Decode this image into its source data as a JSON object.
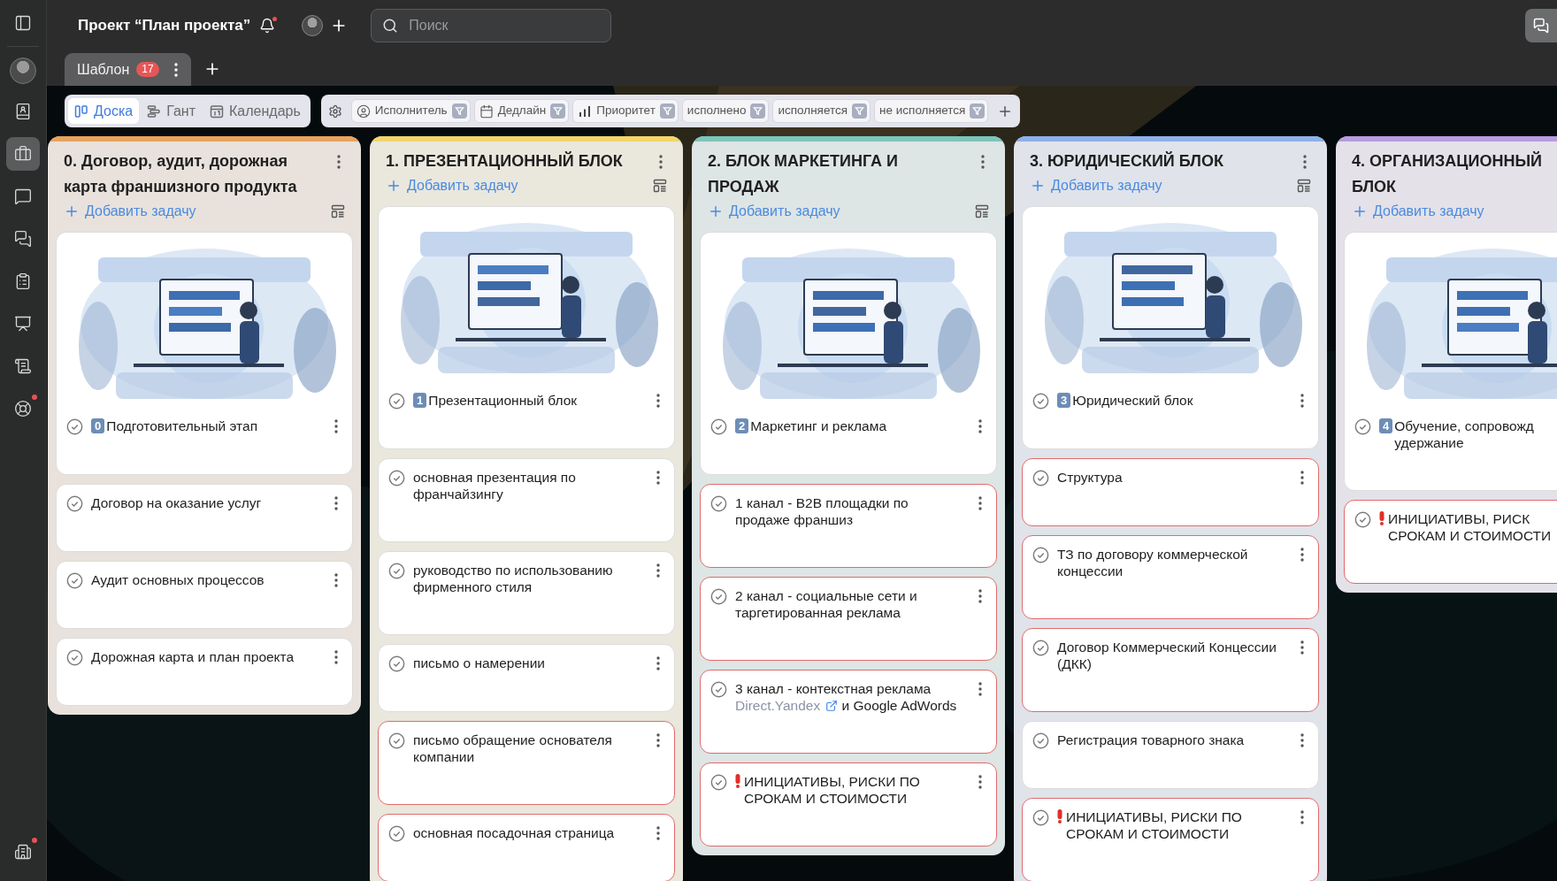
{
  "sidebar": {
    "items": [
      {
        "selected": false,
        "dot": false
      },
      {
        "selected": true,
        "dot": false
      },
      {
        "selected": false,
        "dot": false
      },
      {
        "selected": false,
        "dot": false
      },
      {
        "selected": false,
        "dot": false
      },
      {
        "selected": false,
        "dot": false
      },
      {
        "selected": false,
        "dot": false
      },
      {
        "selected": false,
        "dot": true
      }
    ],
    "bottom": {
      "dot": true
    }
  },
  "header": {
    "title": "Проект “План проекта”",
    "bell_unread": true,
    "search": {
      "placeholder": "Поиск"
    }
  },
  "tabs": [
    {
      "label": "Шаблон",
      "count": "17",
      "selected": true
    }
  ],
  "views": [
    {
      "label": "Доска",
      "selected": true
    },
    {
      "label": "Гант",
      "selected": false
    },
    {
      "label": "Календарь",
      "selected": false
    }
  ],
  "filters": [
    {
      "label": "Исполнитель"
    },
    {
      "label": "Дедлайн"
    },
    {
      "label": "Приоритет"
    },
    {
      "label": "исполнено"
    },
    {
      "label": "исполняется"
    },
    {
      "label": "не исполняется"
    }
  ],
  "columns": [
    {
      "title": "0. Договор, аудит, дорожная карта франшизного продукта",
      "color": "#e8a35c",
      "add_label": "Добавить задачу",
      "tasks": [
        {
          "kind": "cover",
          "number": "0",
          "title": "Подготовительный этап",
          "highlighted": false
        },
        {
          "kind": "task",
          "title": "Договор на оказание услуг",
          "highlighted": false
        },
        {
          "kind": "task",
          "title": "Аудит основных процессов",
          "highlighted": false
        },
        {
          "kind": "task",
          "title": "Дорожная карта и план проекта",
          "highlighted": false
        }
      ]
    },
    {
      "title": "1. ПРЕЗЕНТАЦИОННЫЙ БЛОК",
      "color": "#f3d56a",
      "add_label": "Добавить задачу",
      "tasks": [
        {
          "kind": "cover",
          "number": "1",
          "title": "Презентационный блок",
          "highlighted": false
        },
        {
          "kind": "task",
          "title": "основная презентация по франчайзингу",
          "highlighted": false
        },
        {
          "kind": "task",
          "title": "руководство по использованию фирменного стиля",
          "highlighted": false
        },
        {
          "kind": "task",
          "title": "письмо о намерении",
          "highlighted": false
        },
        {
          "kind": "task",
          "title": "письмо обращение основателя компании",
          "highlighted": true
        },
        {
          "kind": "task",
          "title": "основная посадочная страница",
          "highlighted": true
        }
      ]
    },
    {
      "title": "2. БЛОК МАРКЕТИНГА И ПРОДАЖ",
      "color": "#7cc4bb",
      "add_label": "Добавить задачу",
      "tasks": [
        {
          "kind": "cover",
          "number": "2",
          "title": "Маркетинг и реклама",
          "highlighted": false
        },
        {
          "kind": "task",
          "title": "1 канал - B2B площадки по продаже франшиз",
          "highlighted": true
        },
        {
          "kind": "task",
          "title": "2 канал - социальные сети и таргетированная реклама",
          "highlighted": true
        },
        {
          "kind": "task",
          "title": "3 канал - контекстная реклама",
          "link": "Direct.Yandex",
          "title_after": "и Google AdWords",
          "highlighted": true
        },
        {
          "kind": "task",
          "alert": true,
          "title": "ИНИЦИАТИВЫ, РИСКИ ПО СРОКАМ И СТОИМОСТИ",
          "highlighted": true
        }
      ]
    },
    {
      "title": "3. ЮРИДИЧЕСКИЙ БЛОК",
      "color": "#8eb0ea",
      "add_label": "Добавить задачу",
      "tasks": [
        {
          "kind": "cover",
          "number": "3",
          "title": "Юридический блок",
          "highlighted": false
        },
        {
          "kind": "task",
          "title": "Структура",
          "highlighted": true
        },
        {
          "kind": "task",
          "title": "ТЗ по договору коммерческой концессии",
          "highlighted": true
        },
        {
          "kind": "task",
          "title": "Договор Коммерческий Концессии (ДКК)",
          "highlighted": true
        },
        {
          "kind": "task",
          "title": "Регистрация товарного знака",
          "highlighted": false
        },
        {
          "kind": "task",
          "alert": true,
          "title": "ИНИЦИАТИВЫ, РИСКИ ПО СРОКАМ И СТОИМОСТИ",
          "highlighted": true
        }
      ]
    },
    {
      "title": "4. ОРГАНИЗАЦИОННЫЙ\nБЛОК",
      "color": "#b79ce0",
      "add_label": "Добавить задачу",
      "tasks": [
        {
          "kind": "cover",
          "number": "4",
          "title": "Обучение, сопровожд\nудержание",
          "highlighted": false
        },
        {
          "kind": "task",
          "alert": true,
          "title": "ИНИЦИАТИВЫ, РИСК\nСРОКАМ И СТОИМОСТИ",
          "highlighted": true
        }
      ]
    }
  ]
}
